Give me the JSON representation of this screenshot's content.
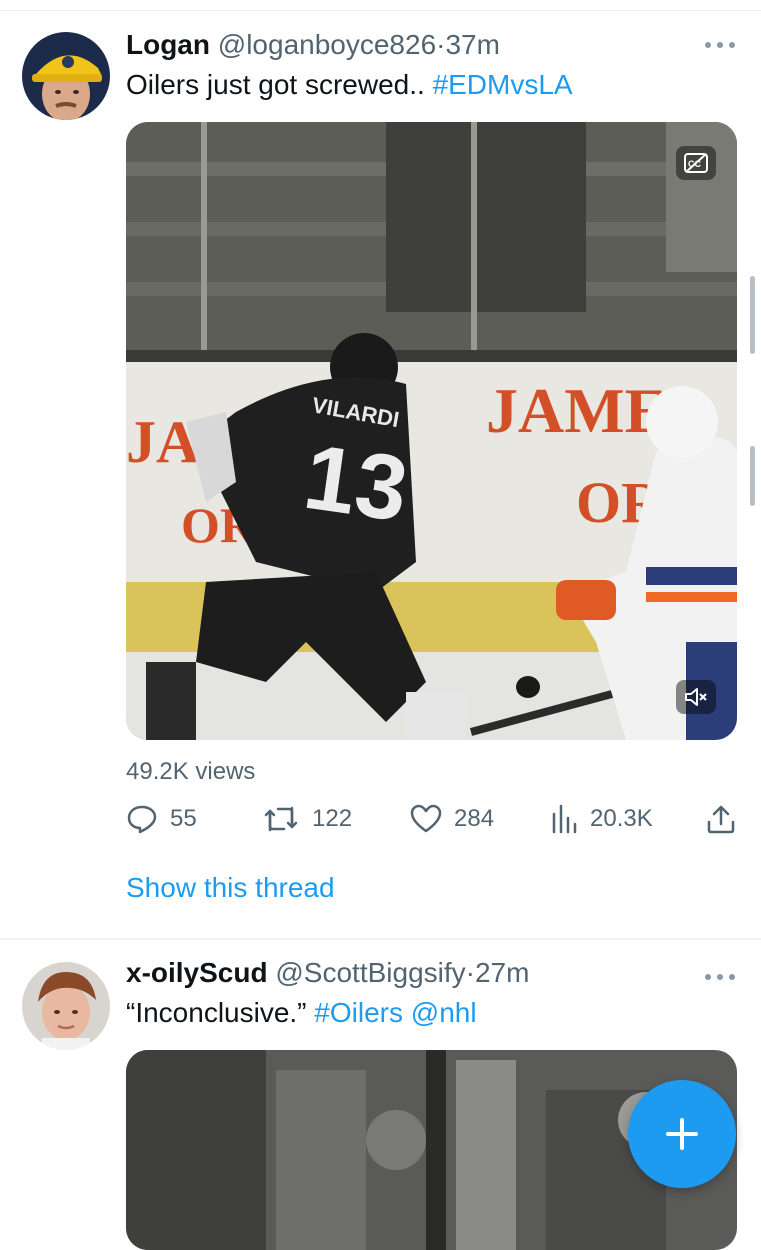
{
  "tweets": [
    {
      "name": "Logan",
      "handle": "@loganboyce826",
      "separator": "·",
      "time": "37m",
      "text": "Oilers just got screwed.. ",
      "hashtag": "#EDMvsLA",
      "media": {
        "jersey_name": "VILARDI",
        "jersey_number": "13",
        "board_word_1": "JAMES",
        "board_word_2": "JAMES",
        "board_word_3": "ORA",
        "board_word_4": "OR"
      },
      "views": "49.2K views",
      "replies": "55",
      "retweets": "122",
      "likes": "284",
      "analytics": "20.3K",
      "show_thread": "Show this thread"
    },
    {
      "name": "x-oilyScud",
      "handle": "@ScottBiggsify",
      "separator": "·",
      "time": "27m",
      "text_quote": "“Inconclusive.” ",
      "hashtag": "#Oilers",
      "mention": "@nhl"
    }
  ],
  "icons": {
    "more": "more-icon",
    "reply": "reply-icon",
    "retweet": "retweet-icon",
    "like": "heart-icon",
    "analytics": "analytics-icon",
    "share": "share-icon",
    "captions": "captions-icon",
    "mute": "mute-icon",
    "compose": "plus-icon"
  },
  "colors": {
    "accent": "#1d9bf0",
    "secondary_text": "#536471",
    "primary_text": "#0f1419"
  }
}
